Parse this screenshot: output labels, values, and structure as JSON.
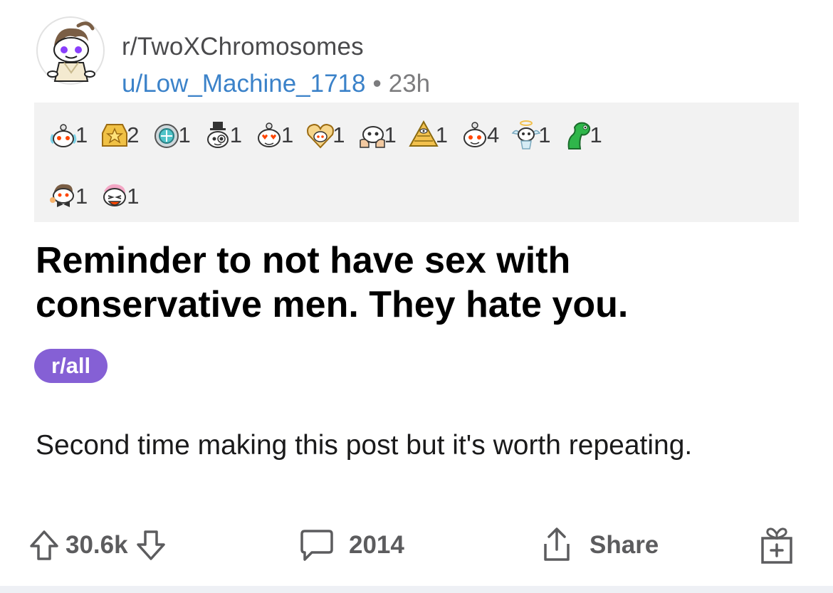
{
  "post": {
    "subreddit": "r/TwoXChromosomes",
    "author": "u/Low_Machine_1718",
    "separator": "•",
    "age": "23h",
    "title": "Reminder to not have sex with conservative men. They hate you.",
    "flair": "r/all",
    "body": "Second time making this post but it's worth repeating."
  },
  "awards": {
    "row1": [
      {
        "icon": "snoo-love-award-icon",
        "count": "1"
      },
      {
        "icon": "gold-award-icon",
        "count": "2"
      },
      {
        "icon": "platinum-award-icon",
        "count": "1"
      },
      {
        "icon": "snoo-top-hat-award-icon",
        "count": "1"
      },
      {
        "icon": "heart-eyes-award-icon",
        "count": "1"
      },
      {
        "icon": "wholesome-heart-award-icon",
        "count": "1"
      },
      {
        "icon": "snoo-hands-award-icon",
        "count": "1"
      },
      {
        "icon": "eye-pyramid-award-icon",
        "count": "1"
      },
      {
        "icon": "snoo-award-icon",
        "count": "4"
      },
      {
        "icon": "angel-snoo-award-icon",
        "count": "1"
      },
      {
        "icon": "green-snake-award-icon",
        "count": "1"
      }
    ],
    "row2": [
      {
        "icon": "snoo-bowtie-award-icon",
        "count": "1"
      },
      {
        "icon": "snoo-laughing-award-icon",
        "count": "1"
      }
    ]
  },
  "actions": {
    "score": "30.6k",
    "comments": "2014",
    "share_label": "Share"
  },
  "colors": {
    "accent_link": "#3b82c9",
    "flair_bg": "#8560d5",
    "awards_bg": "#f2f2f2"
  }
}
